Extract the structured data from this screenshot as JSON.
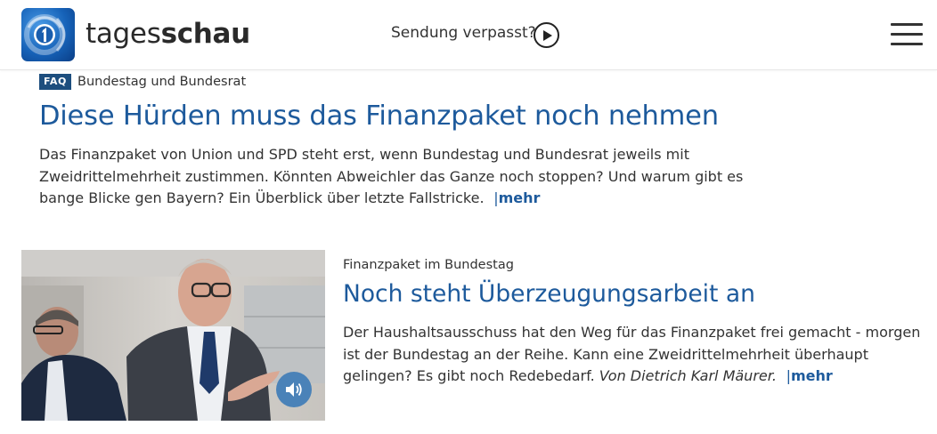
{
  "header": {
    "brand_light": "tages",
    "brand_bold": "schau",
    "missed_label": "Sendung verpasst?"
  },
  "teaser1": {
    "badge": "FAQ",
    "topline": "Bundestag und Bundesrat",
    "headline": "Diese Hürden muss das Finanzpaket noch nehmen",
    "text": "Das Finanzpaket von Union und SPD steht erst, wenn Bundestag und Bundesrat jeweils mit Zweidrittelmehrheit zustimmen. Könnten Abweichler das Ganze noch stoppen? Und warum gibt es bange Blicke gen Bayern? Ein Überblick über letzte Fallstricke.",
    "more_bar": "|",
    "more_label": "mehr"
  },
  "teaser2": {
    "topline": "Finanzpaket im Bundestag",
    "headline": "Noch steht Überzeugungsarbeit an",
    "text": "Der Haushaltsausschuss hat den Weg für das Finanzpaket frei gemacht - morgen ist der Bundestag an der Reihe. Kann eine Zweidrittelmehrheit überhaupt gelingen? Es gibt noch Redebedarf.",
    "author": "Von Dietrich Karl Mäurer.",
    "more_bar": "|",
    "more_label": "mehr"
  },
  "icons": {
    "logo": "tagesschau-logo-icon",
    "play": "play-icon",
    "menu": "hamburger-menu-icon",
    "audio": "speaker-icon"
  },
  "colors": {
    "link": "#1d5a9c",
    "badge": "#1d4e7e",
    "audio_button": "#4a82b8"
  }
}
